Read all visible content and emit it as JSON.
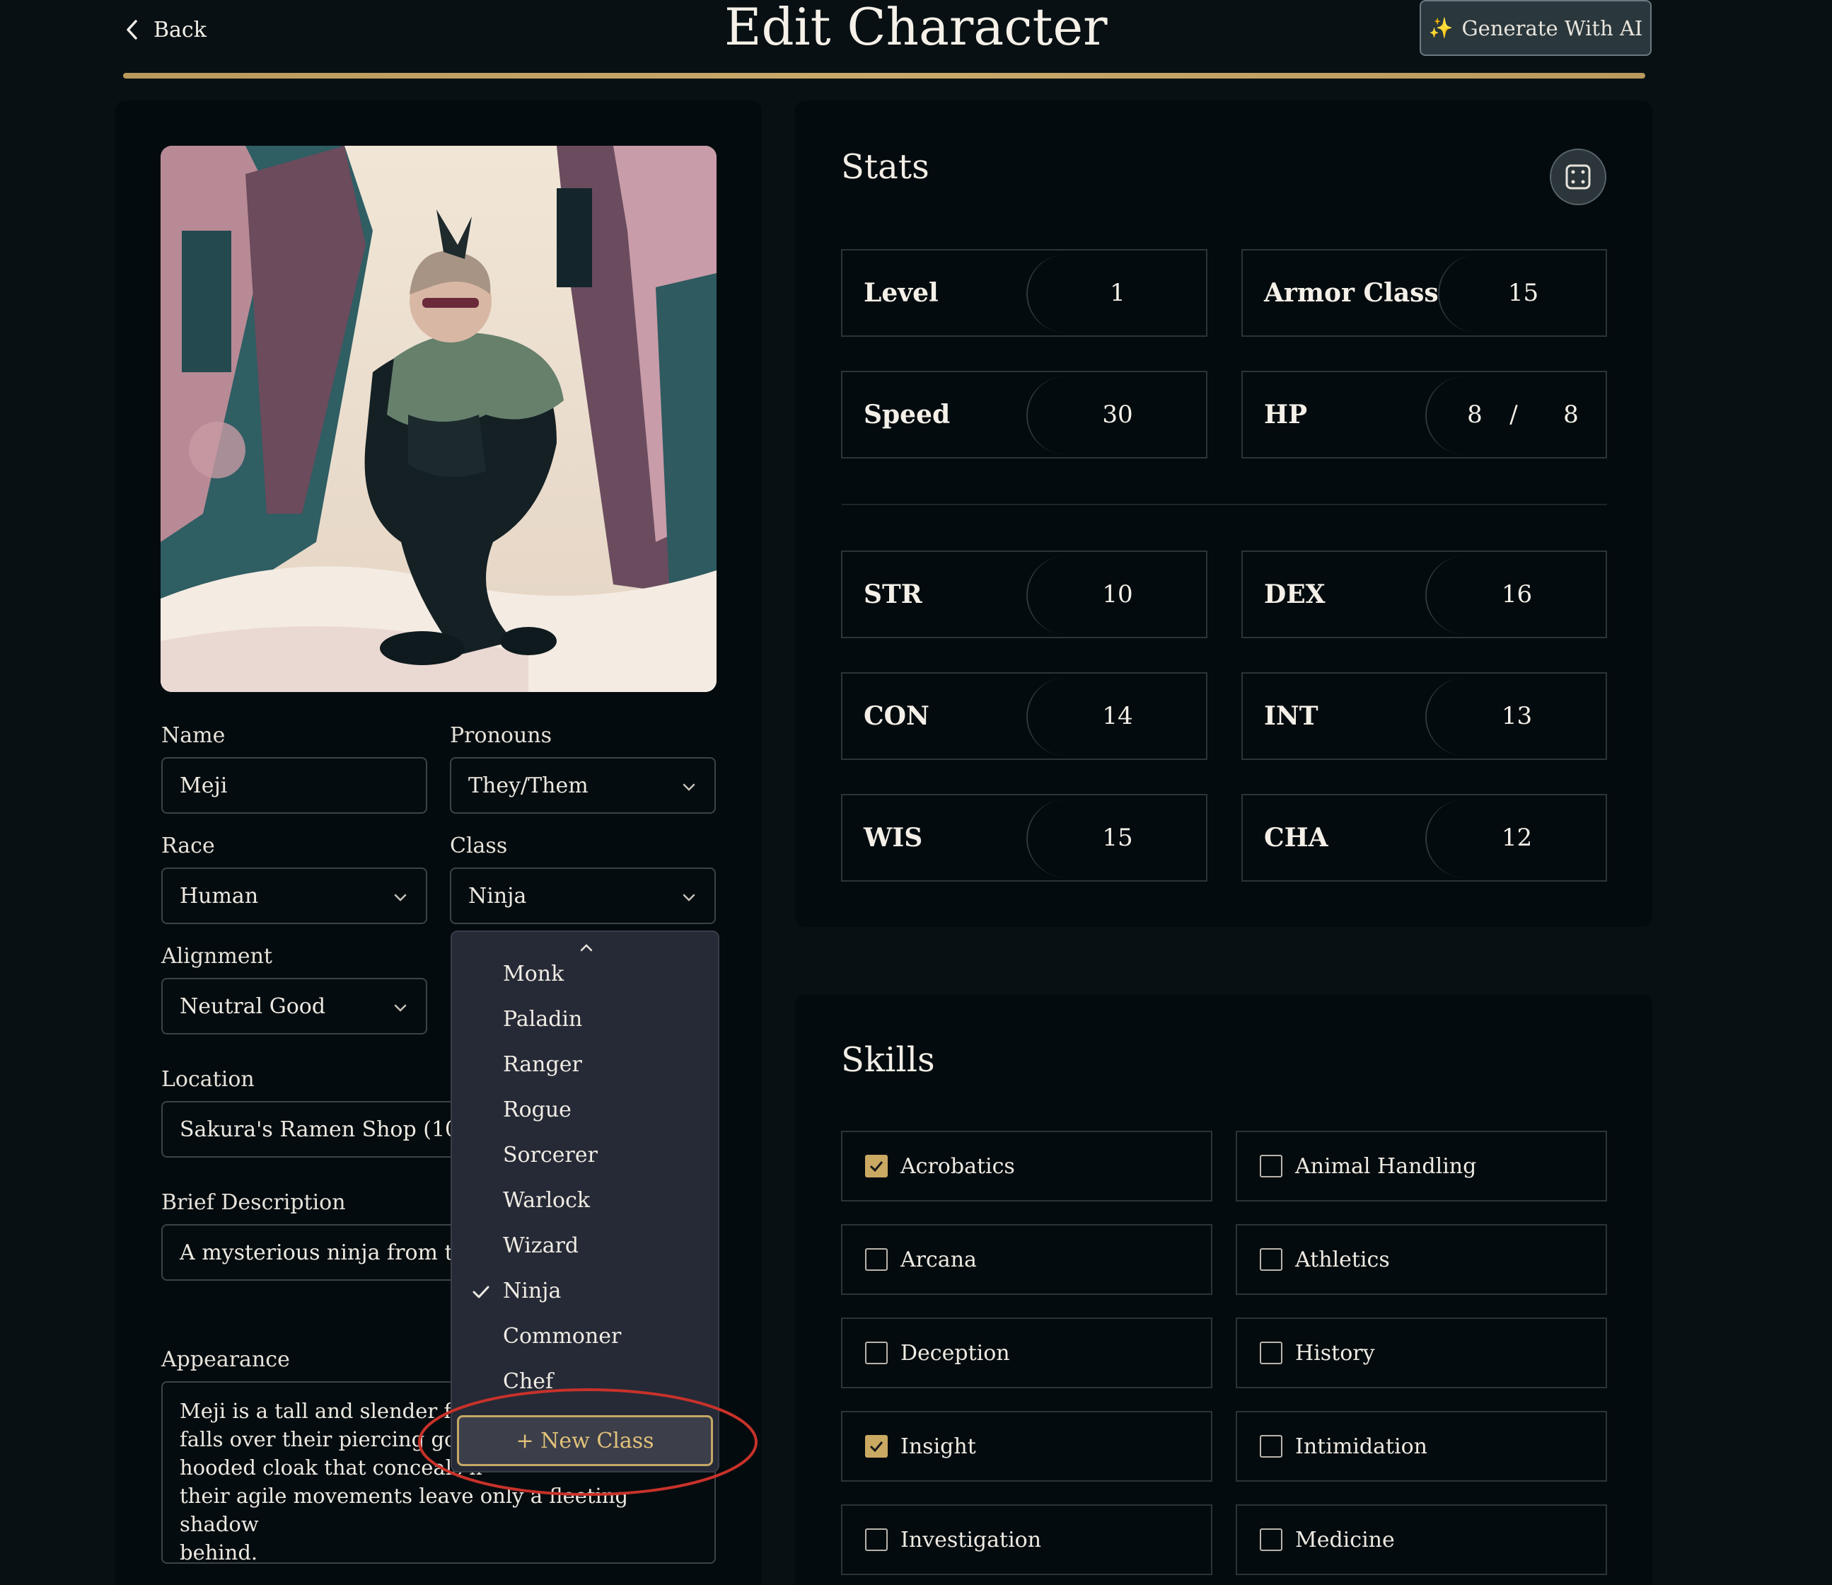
{
  "header": {
    "back_label": "Back",
    "title": "Edit Character",
    "generate_label": "Generate With AI",
    "generate_icon": "sparkles-icon",
    "accent_color": "#c5a766"
  },
  "form": {
    "name_label": "Name",
    "name_value": "Meji",
    "pronouns_label": "Pronouns",
    "pronouns_value": "They/Them",
    "race_label": "Race",
    "race_value": "Human",
    "class_label": "Class",
    "class_value": "Ninja",
    "alignment_label": "Alignment",
    "alignment_value": "Neutral Good",
    "location_label": "Location",
    "location_value": "Sakura's Ramen Shop (10, 10)",
    "brief_label": "Brief Description",
    "brief_value": "A mysterious ninja from the l",
    "appearance_label": "Appearance",
    "appearance_lines": [
      "Meji is a tall and slender figu",
      "falls over their piercing golde",
      "hooded cloak that conceals n",
      "their agile movements leave only a fleeting shadow",
      "behind."
    ]
  },
  "class_dropdown": {
    "items": [
      "Monk",
      "Paladin",
      "Ranger",
      "Rogue",
      "Sorcerer",
      "Warlock",
      "Wizard",
      "Ninja",
      "Commoner",
      "Chef"
    ],
    "selected": "Ninja",
    "new_class_label": "+ New Class"
  },
  "stats": {
    "title": "Stats",
    "level_label": "Level",
    "level_value": "1",
    "armor_label": "Armor Class",
    "armor_value": "15",
    "speed_label": "Speed",
    "speed_value": "30",
    "hp_label": "HP",
    "hp_current": "8",
    "hp_sep": "/",
    "hp_max": "8",
    "str_label": "STR",
    "str_value": "10",
    "dex_label": "DEX",
    "dex_value": "16",
    "con_label": "CON",
    "con_value": "14",
    "int_label": "INT",
    "int_value": "13",
    "wis_label": "WIS",
    "wis_value": "15",
    "cha_label": "CHA",
    "cha_value": "12"
  },
  "skills": {
    "title": "Skills",
    "items": [
      {
        "label": "Acrobatics",
        "checked": true
      },
      {
        "label": "Animal Handling",
        "checked": false
      },
      {
        "label": "Arcana",
        "checked": false
      },
      {
        "label": "Athletics",
        "checked": false
      },
      {
        "label": "Deception",
        "checked": false
      },
      {
        "label": "History",
        "checked": false
      },
      {
        "label": "Insight",
        "checked": true
      },
      {
        "label": "Intimidation",
        "checked": false
      },
      {
        "label": "Investigation",
        "checked": false
      },
      {
        "label": "Medicine",
        "checked": false
      }
    ]
  }
}
